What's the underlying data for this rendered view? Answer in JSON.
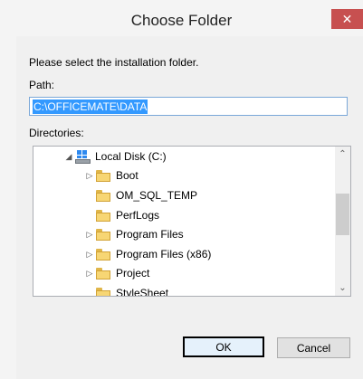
{
  "window": {
    "title": "Choose Folder",
    "close_label": "✕"
  },
  "prompt": "Please select the installation folder.",
  "path": {
    "label": "Path:",
    "value": "C:\\OFFICEMATE\\DATA"
  },
  "directories": {
    "label": "Directories:",
    "root": {
      "label": "Local Disk (C:)",
      "expander": "◢",
      "icon": "drive-icon"
    },
    "items": [
      {
        "label": "Boot",
        "expander": "▷"
      },
      {
        "label": "OM_SQL_TEMP",
        "expander": ""
      },
      {
        "label": "PerfLogs",
        "expander": ""
      },
      {
        "label": "Program Files",
        "expander": "▷"
      },
      {
        "label": "Program Files (x86)",
        "expander": "▷"
      },
      {
        "label": "Project",
        "expander": "▷"
      },
      {
        "label": "StyleSheet",
        "expander": ""
      }
    ]
  },
  "scrollbar": {
    "up_glyph": "⌃",
    "down_glyph": "⌄"
  },
  "buttons": {
    "ok_label": "OK",
    "cancel_label": "Cancel"
  },
  "colors": {
    "accent_selection": "#3399ff",
    "folder_yellow": "#f7d674",
    "close_red": "#c75050"
  }
}
